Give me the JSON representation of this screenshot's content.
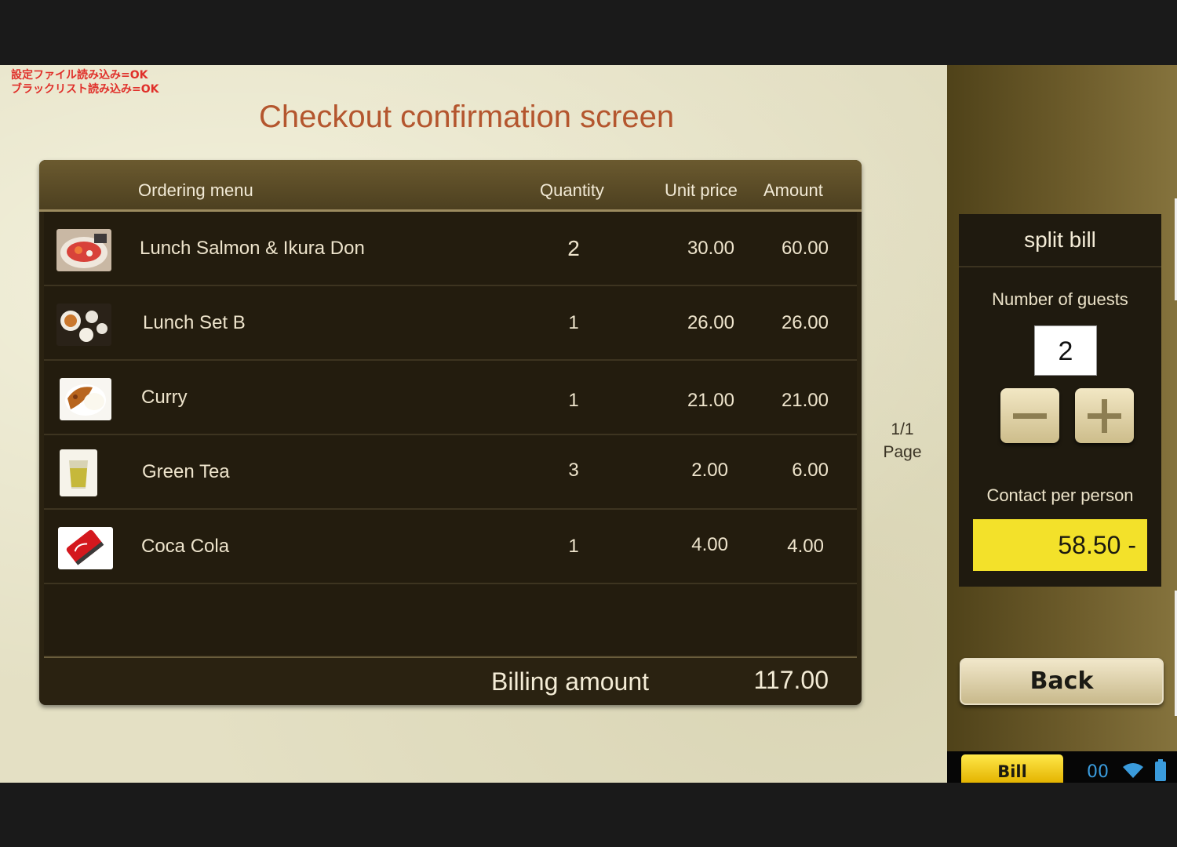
{
  "debug_lines": [
    "設定ファイル読み込み=OK",
    "ブラックリスト読み込み=OK"
  ],
  "page_title": "Checkout confirmation screen",
  "table": {
    "headers": {
      "menu": "Ordering menu",
      "quantity": "Quantity",
      "unit_price": "Unit price",
      "amount": "Amount"
    },
    "rows": [
      {
        "name": "Lunch Salmon & Ikura Don",
        "quantity": "2",
        "unit_price": "30.00",
        "amount": "60.00",
        "icon": "salmon-don-photo"
      },
      {
        "name": "Lunch Set B",
        "quantity": "1",
        "unit_price": "26.00",
        "amount": "26.00",
        "icon": "lunch-set-photo"
      },
      {
        "name": "Curry",
        "quantity": "1",
        "unit_price": "21.00",
        "amount": "21.00",
        "icon": "curry-photo"
      },
      {
        "name": "Green Tea",
        "quantity": "3",
        "unit_price": "2.00",
        "amount": "6.00",
        "icon": "green-tea-photo"
      },
      {
        "name": "Coca Cola",
        "quantity": "1",
        "unit_price": "4.00",
        "amount": "4.00",
        "icon": "coca-cola-photo"
      }
    ],
    "billing_label": "Billing amount",
    "billing_amount": "117.00"
  },
  "pagination": {
    "current": "1/1",
    "label": "Page"
  },
  "split_bill": {
    "title": "split bill",
    "guests_label": "Number of guests",
    "guests_value": "2",
    "minus_icon": "minus-icon",
    "plus_icon": "plus-icon",
    "per_person_label": "Contact per person",
    "per_person_value": "58.50 -"
  },
  "back_button": "Back",
  "status_bar": {
    "bill_tab": "Bill",
    "clock": "00",
    "icons": [
      "wifi-icon",
      "battery-icon"
    ]
  },
  "colors": {
    "title": "#b4562e",
    "panel_dark": "#231c0e",
    "header_brown": "#6b5a2f",
    "highlight_yellow": "#f3e12a",
    "debug_red": "#e0302a"
  }
}
